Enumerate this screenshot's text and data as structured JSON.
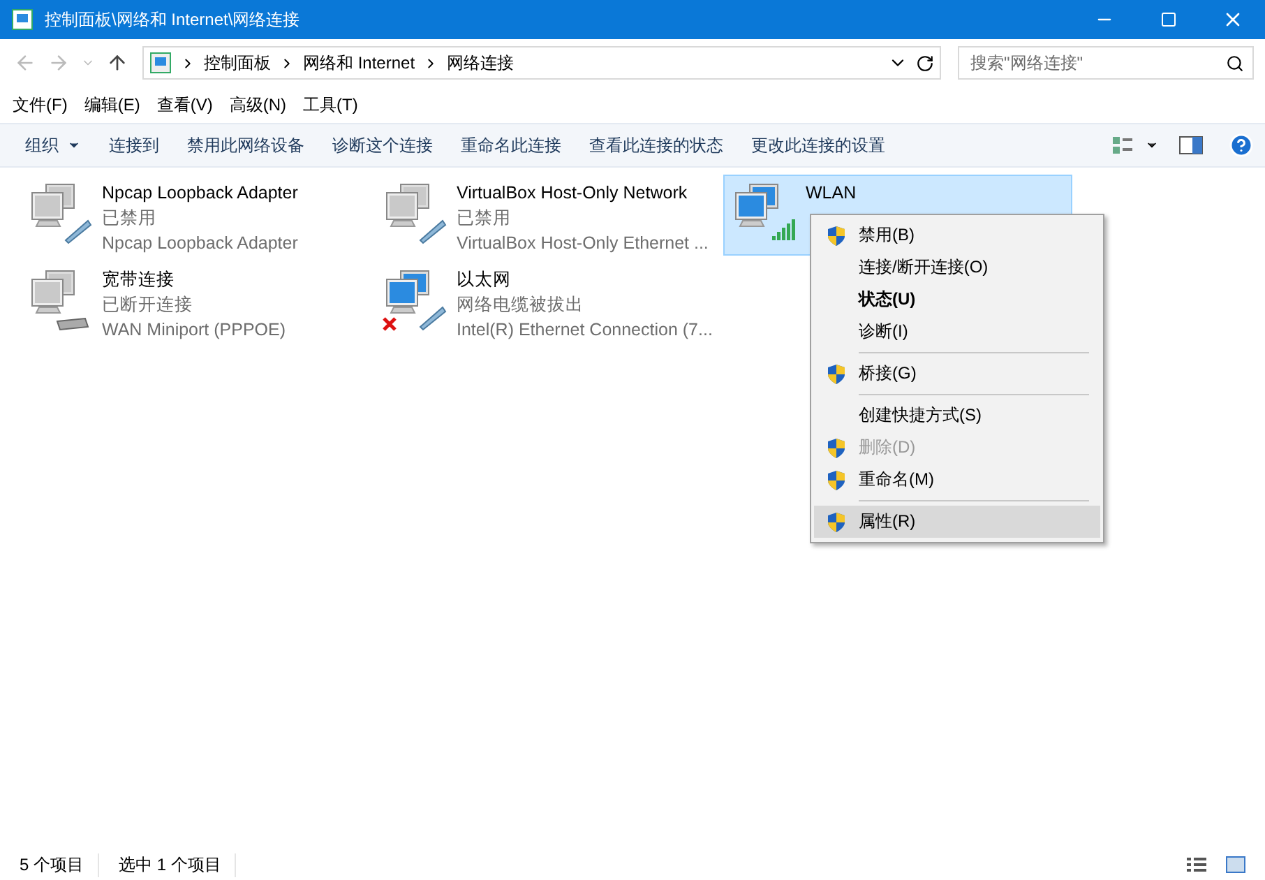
{
  "window": {
    "title": "控制面板\\网络和 Internet\\网络连接"
  },
  "address": {
    "crumbs": [
      "控制面板",
      "网络和 Internet",
      "网络连接"
    ],
    "search_placeholder": "搜索\"网络连接\""
  },
  "menu_bar": [
    "文件(F)",
    "编辑(E)",
    "查看(V)",
    "高级(N)",
    "工具(T)"
  ],
  "command_bar": [
    {
      "label": "组织",
      "dropdown": true
    },
    {
      "label": "连接到",
      "dropdown": false
    },
    {
      "label": "禁用此网络设备",
      "dropdown": false
    },
    {
      "label": "诊断这个连接",
      "dropdown": false
    },
    {
      "label": "重命名此连接",
      "dropdown": false
    },
    {
      "label": "查看此连接的状态",
      "dropdown": false
    },
    {
      "label": "更改此连接的设置",
      "dropdown": false
    }
  ],
  "connections": [
    {
      "name": "Npcap Loopback Adapter",
      "status": "已禁用",
      "device": "Npcap Loopback Adapter",
      "kind": "ethernet",
      "active": false,
      "error": false,
      "selected": false
    },
    {
      "name": "VirtualBox Host-Only Network",
      "status": "已禁用",
      "device": "VirtualBox Host-Only Ethernet ...",
      "kind": "ethernet",
      "active": false,
      "error": false,
      "selected": false
    },
    {
      "name": "WLAN",
      "kind": "wifi",
      "active": true,
      "error": false,
      "selected": true
    },
    {
      "name": "宽带连接",
      "status": "已断开连接",
      "device": "WAN Miniport (PPPOE)",
      "kind": "modem",
      "active": false,
      "error": false,
      "selected": false
    },
    {
      "name": "以太网",
      "status": "网络电缆被拔出",
      "device": "Intel(R) Ethernet Connection (7...",
      "kind": "ethernet",
      "active": true,
      "error": true,
      "selected": false
    }
  ],
  "context_menu": [
    {
      "kind": "item",
      "label": "禁用(B)",
      "shield": true,
      "bold": false,
      "disabled": false,
      "selected": false
    },
    {
      "kind": "item",
      "label": "连接/断开连接(O)",
      "shield": false,
      "bold": false,
      "disabled": false,
      "selected": false
    },
    {
      "kind": "item",
      "label": "状态(U)",
      "shield": false,
      "bold": true,
      "disabled": false,
      "selected": false
    },
    {
      "kind": "item",
      "label": "诊断(I)",
      "shield": false,
      "bold": false,
      "disabled": false,
      "selected": false
    },
    {
      "kind": "separator"
    },
    {
      "kind": "item",
      "label": "桥接(G)",
      "shield": true,
      "bold": false,
      "disabled": false,
      "selected": false
    },
    {
      "kind": "separator"
    },
    {
      "kind": "item",
      "label": "创建快捷方式(S)",
      "shield": false,
      "bold": false,
      "disabled": false,
      "selected": false
    },
    {
      "kind": "item",
      "label": "删除(D)",
      "shield": true,
      "bold": false,
      "disabled": true,
      "selected": false
    },
    {
      "kind": "item",
      "label": "重命名(M)",
      "shield": true,
      "bold": false,
      "disabled": false,
      "selected": false
    },
    {
      "kind": "separator"
    },
    {
      "kind": "item",
      "label": "属性(R)",
      "shield": true,
      "bold": false,
      "disabled": false,
      "selected": true
    }
  ],
  "status_bar": [
    "5 个项目",
    "选中 1 个项目"
  ]
}
